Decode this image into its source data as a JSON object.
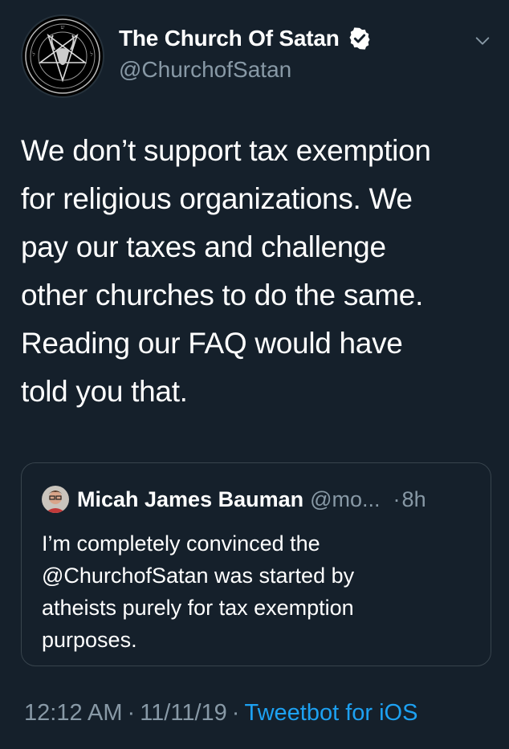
{
  "tweet": {
    "author": {
      "display_name": "The Church Of Satan",
      "handle": "@ChurchofSatan",
      "verified": true,
      "avatar_icon": "sigil-of-baphomet-icon"
    },
    "text": "We don’t support tax exemption\nfor religious organizations. We\npay our taxes and challenge\nother churches to do the same.\nReading our FAQ would have\ntold you that.",
    "time": "12:12 AM",
    "date": "11/11/19",
    "separator": "·",
    "source": "Tweetbot for iOS"
  },
  "quoted_tweet": {
    "author": {
      "display_name": "Micah James Bauman",
      "handle": "@mo...",
      "avatar_icon": "user-photo-avatar"
    },
    "time_separator": "·",
    "time": "8h",
    "text": "I’m completely convinced the\n@ChurchofSatan was started by\natheists purely for tax exemption\npurposes."
  },
  "colors": {
    "background": "#15202b",
    "text_primary": "#ffffff",
    "text_secondary": "#8899a6",
    "link": "#1da1f2",
    "border": "#38444d"
  },
  "icons": {
    "verified": "verified-badge-icon",
    "menu": "chevron-down-icon"
  }
}
